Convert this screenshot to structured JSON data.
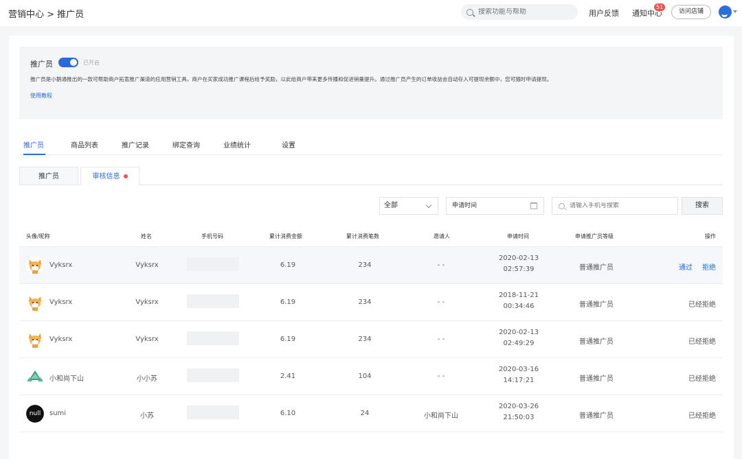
{
  "breadcrumb": "营销中心 > 推广员",
  "header": {
    "search_placeholder": "搜索功能与帮助",
    "feedback": "用户反馈",
    "notifications": "通知中心",
    "notification_count": "51",
    "visit_store": "访问店铺"
  },
  "intro": {
    "title": "推广员",
    "toggle_on": true,
    "toggle_status": "已开启",
    "description": "推广员是小鹅通推出的一款可帮助商户拓宽推广渠道的应用营销工具，商户在买家成功推广课程后给予奖励，以此给商户带来更多传播和促进销量提升。通过推广员产生的订单收益会自动存入可提现余额中，您可随时申请提现。",
    "tutorial_link": "使用教程"
  },
  "tabs": [
    "推广员",
    "商品列表",
    "推广记录",
    "绑定查询",
    "业绩统计",
    "设置"
  ],
  "active_tab": 0,
  "subtabs": [
    "推广员",
    "审核信息"
  ],
  "active_subtab": 1,
  "filters": {
    "status_selected": "全部",
    "date_placeholder": "申请时间",
    "phone_placeholder": "请输入手机号搜索",
    "search_button": "搜索"
  },
  "table": {
    "columns": [
      "头像/昵称",
      "姓名",
      "手机号码",
      "累计消费金额",
      "累计消费笔数",
      "邀请人",
      "申请时间",
      "申请推广员等级",
      "操作"
    ],
    "rows": [
      {
        "avatar": "fox-avatar",
        "nickname": "Vyksrx",
        "name": "Vyksrx",
        "amount": "6.19",
        "count": "234",
        "inviter": "- -",
        "date": "2020-02-13",
        "time": "02:57:39",
        "level": "普通推广员",
        "actions": [
          "通过",
          "拒绝"
        ],
        "status": ""
      },
      {
        "avatar": "fox-avatar",
        "nickname": "Vyksrx",
        "name": "Vyksrx",
        "amount": "6.19",
        "count": "234",
        "inviter": "- -",
        "date": "2018-11-21",
        "time": "00:34:46",
        "level": "普通推广员",
        "actions": [],
        "status": "已经拒绝"
      },
      {
        "avatar": "fox-avatar",
        "nickname": "Vyksrx",
        "name": "Vyksrx",
        "amount": "6.19",
        "count": "234",
        "inviter": "- -",
        "date": "2020-02-13",
        "time": "02:49:29",
        "level": "普通推广员",
        "actions": [],
        "status": "已经拒绝"
      },
      {
        "avatar": "tree-avatar",
        "nickname": "小和尚下山",
        "name": "小小苏",
        "amount": "2.41",
        "count": "104",
        "inviter": "- -",
        "date": "2020-03-16",
        "time": "14:17:21",
        "level": "普通推广员",
        "actions": [],
        "status": "已经拒绝"
      },
      {
        "avatar": "null-avatar",
        "avatar_text": "null",
        "nickname": "sumi",
        "name": "小苏",
        "amount": "6.10",
        "count": "24",
        "inviter": "小和尚下山",
        "date": "2020-03-26",
        "time": "21:50:03",
        "level": "普通推广员",
        "actions": [],
        "status": "已经拒绝"
      }
    ]
  },
  "colors": {
    "accent": "#2a6ae0",
    "badge": "#f5504d"
  }
}
